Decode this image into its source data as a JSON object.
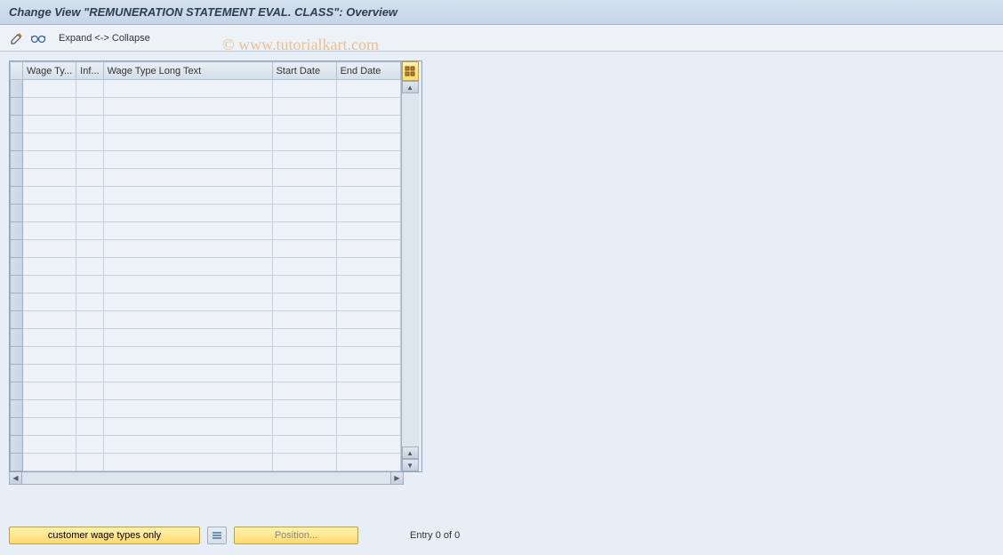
{
  "titleBar": {
    "text": "Change View \"REMUNERATION STATEMENT EVAL. CLASS\": Overview"
  },
  "toolbar": {
    "expandCollapse": "Expand <-> Collapse"
  },
  "watermark": "© www.tutorialkart.com",
  "table": {
    "columns": {
      "wageType": "Wage Ty...",
      "inf": "Inf...",
      "longText": "Wage Type Long Text",
      "startDate": "Start Date",
      "endDate": "End Date"
    },
    "rowCount": 22
  },
  "bottomBar": {
    "customerBtn": "customer wage types only",
    "positionBtn": "Position...",
    "entryText": "Entry 0 of 0"
  }
}
